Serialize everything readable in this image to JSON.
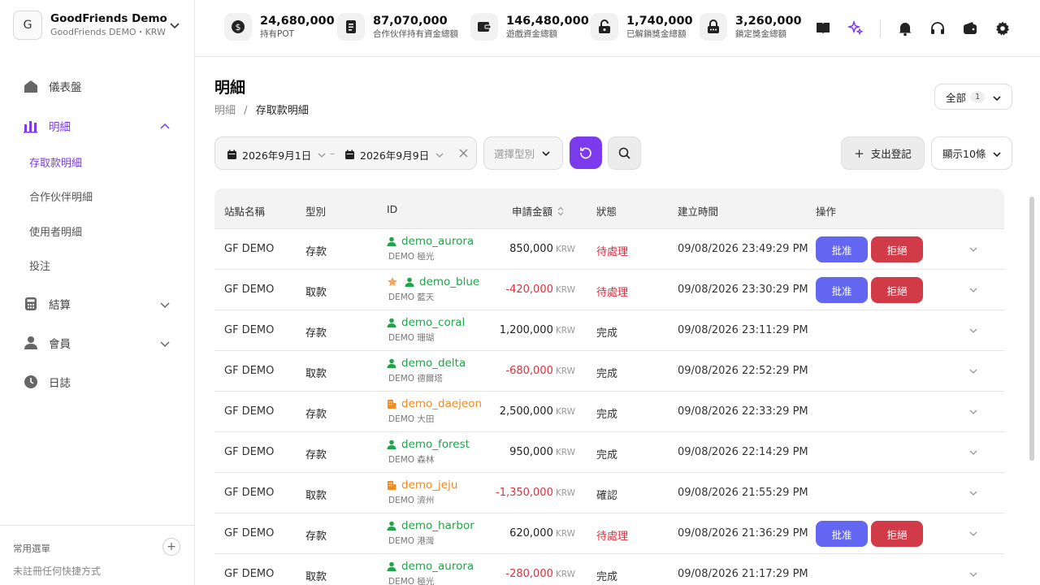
{
  "workspace": {
    "initial": "G",
    "name": "GoodFriends Demo",
    "sub": "GoodFriends DEMO・KRW"
  },
  "stats": [
    {
      "value": "24,680,000",
      "label": "持有POT",
      "icon": "dollar-coin-icon"
    },
    {
      "value": "87,070,000",
      "label": "合作伙伴持有資金總額",
      "icon": "receipt-icon"
    },
    {
      "value": "146,480,000",
      "label": "遊戲資金總額",
      "icon": "wallet-icon"
    },
    {
      "value": "1,740,000",
      "label": "已解鎖獎金總額",
      "icon": "unlock-icon"
    },
    {
      "value": "3,260,000",
      "label": "鎖定獎金總額",
      "icon": "lock-icon"
    }
  ],
  "sidebar": {
    "items": [
      {
        "label": "儀表盤",
        "icon": "home-icon"
      },
      {
        "label": "明細",
        "icon": "bar-chart-icon"
      },
      {
        "label": "結算",
        "icon": "calculator-icon"
      },
      {
        "label": "會員",
        "icon": "user-icon"
      },
      {
        "label": "日誌",
        "icon": "clock-icon"
      }
    ],
    "subitems": [
      "存取款明細",
      "合作伙伴明細",
      "使用者明細",
      "投注"
    ],
    "footer_title": "常用選單",
    "footer_empty": "未註冊任何快捷方式"
  },
  "page": {
    "title": "明細",
    "breadcrumb_parent": "明細",
    "breadcrumb_sep": "/",
    "breadcrumb_current": "存取款明細",
    "all_label": "全部",
    "all_count": "1"
  },
  "filters": {
    "start_date": "2026年9月1日",
    "end_date": "2026年9月9日",
    "range_sep": "–",
    "type_placeholder": "選擇型別",
    "payout_label": "支出登記",
    "show_label": "顯示10條"
  },
  "table": {
    "headers": [
      "站點名稱",
      "型別",
      "ID",
      "申請金額",
      "狀態",
      "建立時間",
      "操作"
    ],
    "currency": "KRW",
    "approve_label": "批准",
    "reject_label": "拒絕",
    "rows": [
      {
        "site": "GF DEMO",
        "type": "存款",
        "user": "demo_aurora",
        "sub": "DEMO 極光",
        "kind": "user",
        "star": false,
        "amount": "850,000",
        "neg": false,
        "status": "待處理",
        "pending": true,
        "time": "09/08/2026 23:49:29 PM",
        "actions": true
      },
      {
        "site": "GF DEMO",
        "type": "取款",
        "user": "demo_blue",
        "sub": "DEMO 藍天",
        "kind": "user",
        "star": true,
        "amount": "-420,000",
        "neg": true,
        "status": "待處理",
        "pending": true,
        "time": "09/08/2026 23:30:29 PM",
        "actions": true
      },
      {
        "site": "GF DEMO",
        "type": "存款",
        "user": "demo_coral",
        "sub": "DEMO 珊瑚",
        "kind": "user",
        "star": false,
        "amount": "1,200,000",
        "neg": false,
        "status": "完成",
        "pending": false,
        "time": "09/08/2026 23:11:29 PM",
        "actions": false
      },
      {
        "site": "GF DEMO",
        "type": "取款",
        "user": "demo_delta",
        "sub": "DEMO 德爾塔",
        "kind": "user",
        "star": false,
        "amount": "-680,000",
        "neg": true,
        "status": "完成",
        "pending": false,
        "time": "09/08/2026 22:52:29 PM",
        "actions": false
      },
      {
        "site": "GF DEMO",
        "type": "存款",
        "user": "demo_daejeon",
        "sub": "DEMO 大田",
        "kind": "partner",
        "star": false,
        "amount": "2,500,000",
        "neg": false,
        "status": "完成",
        "pending": false,
        "time": "09/08/2026 22:33:29 PM",
        "actions": false
      },
      {
        "site": "GF DEMO",
        "type": "存款",
        "user": "demo_forest",
        "sub": "DEMO 森林",
        "kind": "user",
        "star": false,
        "amount": "950,000",
        "neg": false,
        "status": "完成",
        "pending": false,
        "time": "09/08/2026 22:14:29 PM",
        "actions": false
      },
      {
        "site": "GF DEMO",
        "type": "取款",
        "user": "demo_jeju",
        "sub": "DEMO 濟州",
        "kind": "partner",
        "star": false,
        "amount": "-1,350,000",
        "neg": true,
        "status": "確認",
        "pending": false,
        "time": "09/08/2026 21:55:29 PM",
        "actions": false
      },
      {
        "site": "GF DEMO",
        "type": "存款",
        "user": "demo_harbor",
        "sub": "DEMO 港灣",
        "kind": "user",
        "star": false,
        "amount": "620,000",
        "neg": false,
        "status": "待處理",
        "pending": true,
        "time": "09/08/2026 21:36:29 PM",
        "actions": true
      },
      {
        "site": "GF DEMO",
        "type": "取款",
        "user": "demo_aurora",
        "sub": "DEMO 極光",
        "kind": "user",
        "star": false,
        "amount": "-280,000",
        "neg": true,
        "status": "完成",
        "pending": false,
        "time": "09/08/2026 21:17:29 PM",
        "actions": false
      }
    ]
  },
  "colors": {
    "accent": "#7c3aed",
    "approve": "#6366f1",
    "reject": "#d13b48",
    "user_green": "#22a34a",
    "partner_orange": "#f08a24",
    "negative": "#e02e3c"
  }
}
